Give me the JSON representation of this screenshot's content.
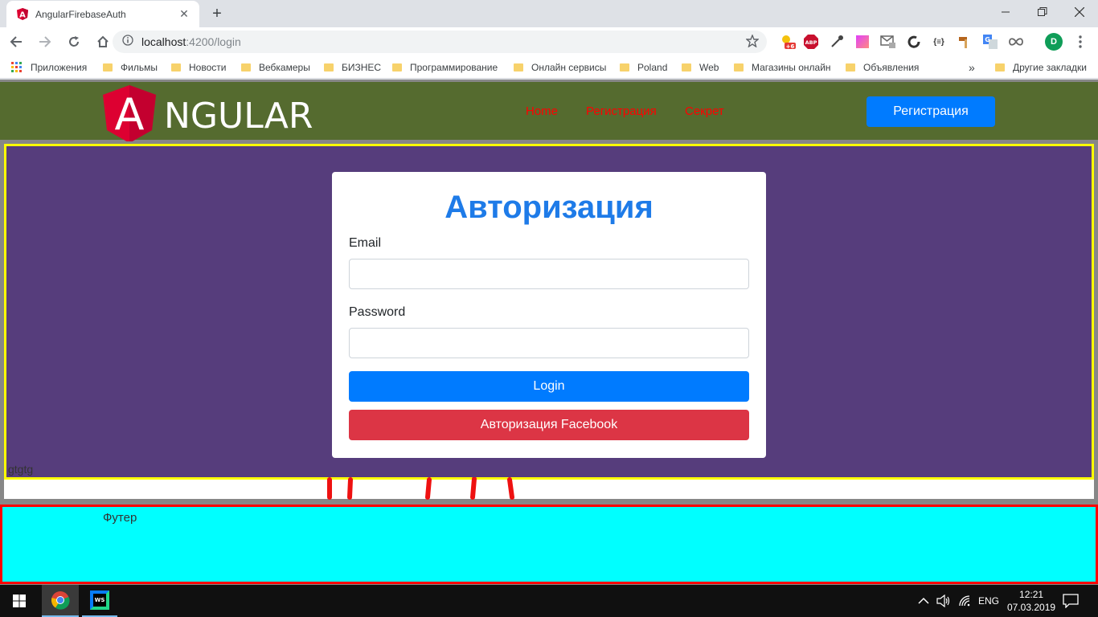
{
  "browser": {
    "tab_title": "AngularFirebaseAuth",
    "tab_close": "✕",
    "new_tab": "+",
    "url_host": "localhost",
    "url_path": ":4200/login",
    "abp_label": "ABP",
    "weather_badge": "+6",
    "translate_label": "{≡}",
    "profile_initial": "D"
  },
  "bookmarks": {
    "apps_label": "Приложения",
    "items": [
      "Фильмы",
      "Новости",
      "Вебкамеры",
      "БИЗНЕС",
      "Программирование",
      "Онлайн сервисы",
      "Poland",
      "Web",
      "Магазины онлайн",
      "Объявления"
    ],
    "more": "»",
    "other": "Другие закладки"
  },
  "navbar": {
    "logo_text": "NGULAR",
    "logo_letter": "A",
    "links": [
      "Home",
      "Регистрация",
      "Секрет"
    ],
    "register_button": "Регистрация"
  },
  "main": {
    "title": "Авторизация",
    "email_label": "Email",
    "email_value": "",
    "password_label": "Password",
    "password_value": "",
    "login_button": "Login",
    "facebook_button": "Авторизация Facebook",
    "stray_text": "gtgtg"
  },
  "footer": {
    "text": "Футер"
  },
  "taskbar": {
    "ws_label": "WS",
    "language": "ENG",
    "time": "12:21",
    "date": "07.03.2019"
  },
  "colors": {
    "navbar_bg": "#556b2f",
    "main_bg": "#563d7c",
    "main_border": "#ffff00",
    "footer_bg": "#00ffff",
    "footer_border": "#ff0000",
    "primary": "#007bff",
    "danger": "#dc3545",
    "nav_link": "#ff0000",
    "title": "#1e7be8"
  }
}
